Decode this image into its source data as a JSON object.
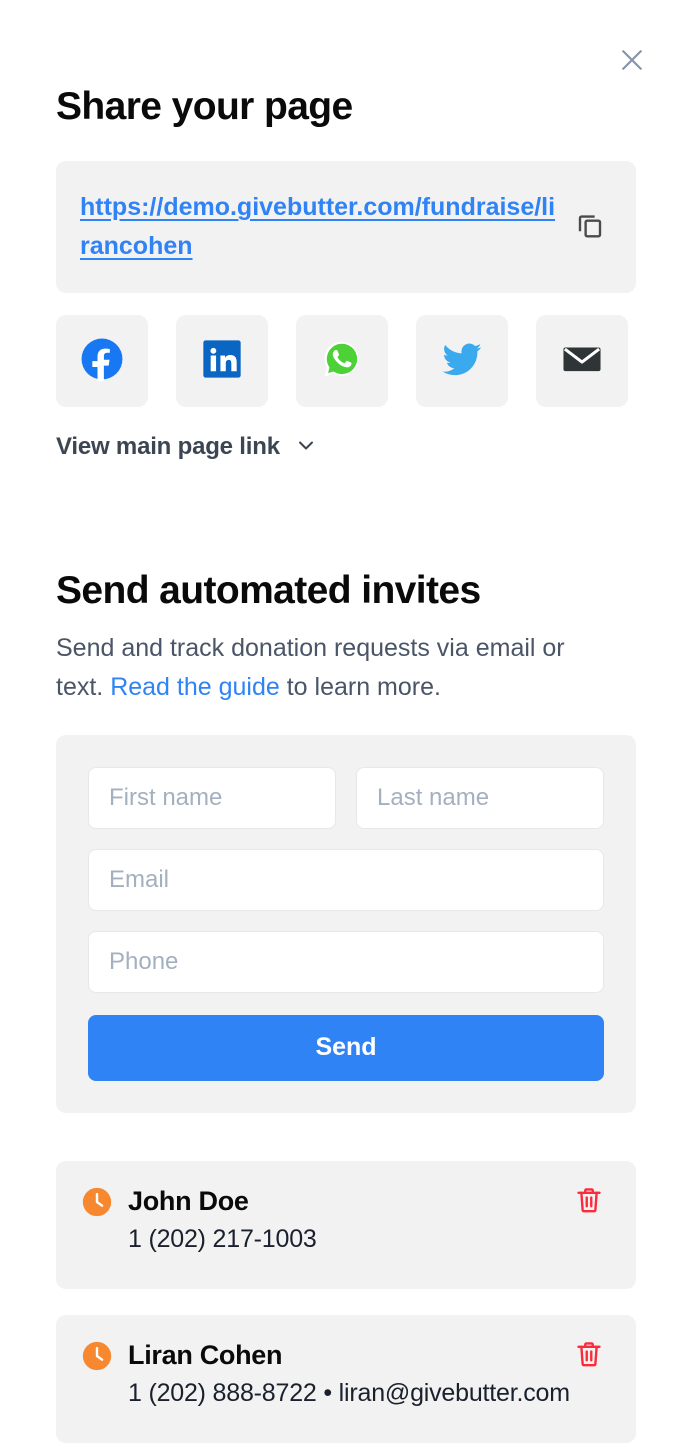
{
  "modal": {
    "close_label": "Close",
    "share": {
      "title": "Share your page",
      "url": "https://demo.givebutter.com/fundraise/lirancohen",
      "copy_icon": "copy-icon",
      "social_buttons": [
        {
          "name": "facebook",
          "label": "Facebook",
          "color": "#1877F2"
        },
        {
          "name": "linkedin",
          "label": "LinkedIn",
          "color": "#0A66C2"
        },
        {
          "name": "whatsapp",
          "label": "WhatsApp",
          "color": "#4CD137"
        },
        {
          "name": "twitter",
          "label": "Twitter",
          "color": "#3BA9EE"
        },
        {
          "name": "email",
          "label": "Email",
          "color": "#2F3437"
        }
      ],
      "view_main_page_link": "View main page link",
      "chevron_icon": "chevron-down-icon"
    },
    "invites": {
      "title": "Send automated invites",
      "desc_part1": "Send and track donation requests via email or text. ",
      "desc_link": "Read the guide",
      "desc_part2": " to learn more.",
      "form": {
        "first_name_placeholder": "First name",
        "last_name_placeholder": "Last name",
        "email_placeholder": "Email",
        "phone_placeholder": "Phone",
        "first_name_value": "",
        "last_name_value": "",
        "email_value": "",
        "phone_value": "",
        "send_label": "Send",
        "send_color": "#3083F5"
      },
      "contacts": [
        {
          "name": "John Doe",
          "details": "1 (202) 217-1003",
          "status_icon": "clock-icon",
          "status_color": "#F7882F",
          "delete_icon": "trash-icon",
          "delete_color": "#FC2B3A"
        },
        {
          "name": "Liran Cohen",
          "details": "1 (202) 888-8722 • liran@givebutter.com",
          "status_icon": "clock-icon",
          "status_color": "#F7882F",
          "delete_icon": "trash-icon",
          "delete_color": "#FC2B3A"
        }
      ]
    }
  }
}
